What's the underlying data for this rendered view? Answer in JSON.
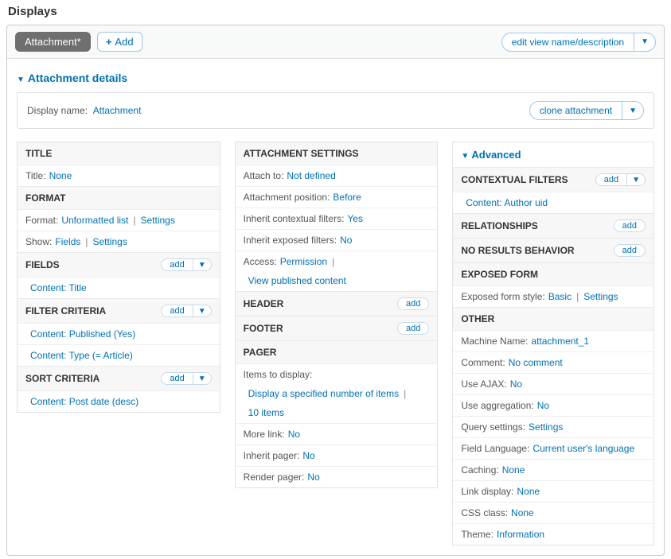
{
  "heading": "Displays",
  "topbar": {
    "tab": "Attachment*",
    "add": "Add",
    "edit": "edit view name/description"
  },
  "details": {
    "title": "Attachment details",
    "display_name_label": "Display name:",
    "display_name_value": "Attachment",
    "clone": "clone attachment"
  },
  "col1": {
    "title_head": "TITLE",
    "title_label": "Title:",
    "title_value": "None",
    "format_head": "FORMAT",
    "format_label": "Format:",
    "format_value": "Unformatted list",
    "format_settings": "Settings",
    "show_label": "Show:",
    "show_value": "Fields",
    "show_settings": "Settings",
    "fields_head": "FIELDS",
    "add": "add",
    "fields_item1": "Content: Title",
    "filter_head": "FILTER CRITERIA",
    "filter_item1": "Content: Published (Yes)",
    "filter_item2": "Content: Type (= Article)",
    "sort_head": "SORT CRITERIA",
    "sort_item1": "Content: Post date (desc)"
  },
  "col2": {
    "attach_head": "ATTACHMENT SETTINGS",
    "attach_to_label": "Attach to:",
    "attach_to_value": "Not defined",
    "pos_label": "Attachment position:",
    "pos_value": "Before",
    "ictx_label": "Inherit contextual filters:",
    "ictx_value": "Yes",
    "iexp_label": "Inherit exposed filters:",
    "iexp_value": "No",
    "access_label": "Access:",
    "access_value": "Permission",
    "access_view": "View published content",
    "header_head": "HEADER",
    "footer_head": "FOOTER",
    "pager_head": "PAGER",
    "items_label": "Items to display:",
    "items_value1": "Display a specified number of items",
    "items_value2": "10 items",
    "more_label": "More link:",
    "more_value": "No",
    "ipager_label": "Inherit pager:",
    "ipager_value": "No",
    "rpager_label": "Render pager:",
    "rpager_value": "No",
    "add": "add"
  },
  "col3": {
    "adv": "Advanced",
    "ctx_head": "CONTEXTUAL FILTERS",
    "add": "add",
    "ctx_item1": "Content: Author uid",
    "rel_head": "RELATIONSHIPS",
    "nores_head": "NO RESULTS BEHAVIOR",
    "expform_head": "EXPOSED FORM",
    "expform_label": "Exposed form style:",
    "expform_value": "Basic",
    "expform_settings": "Settings",
    "other_head": "OTHER",
    "mname_label": "Machine Name:",
    "mname_value": "attachment_1",
    "comment_label": "Comment:",
    "comment_value": "No comment",
    "ajax_label": "Use AJAX:",
    "ajax_value": "No",
    "agg_label": "Use aggregation:",
    "agg_value": "No",
    "qset_label": "Query settings:",
    "qset_value": "Settings",
    "flang_label": "Field Language:",
    "flang_value": "Current user's language",
    "cache_label": "Caching:",
    "cache_value": "None",
    "link_label": "Link display:",
    "link_value": "None",
    "css_label": "CSS class:",
    "css_value": "None",
    "theme_label": "Theme:",
    "theme_value": "Information"
  }
}
